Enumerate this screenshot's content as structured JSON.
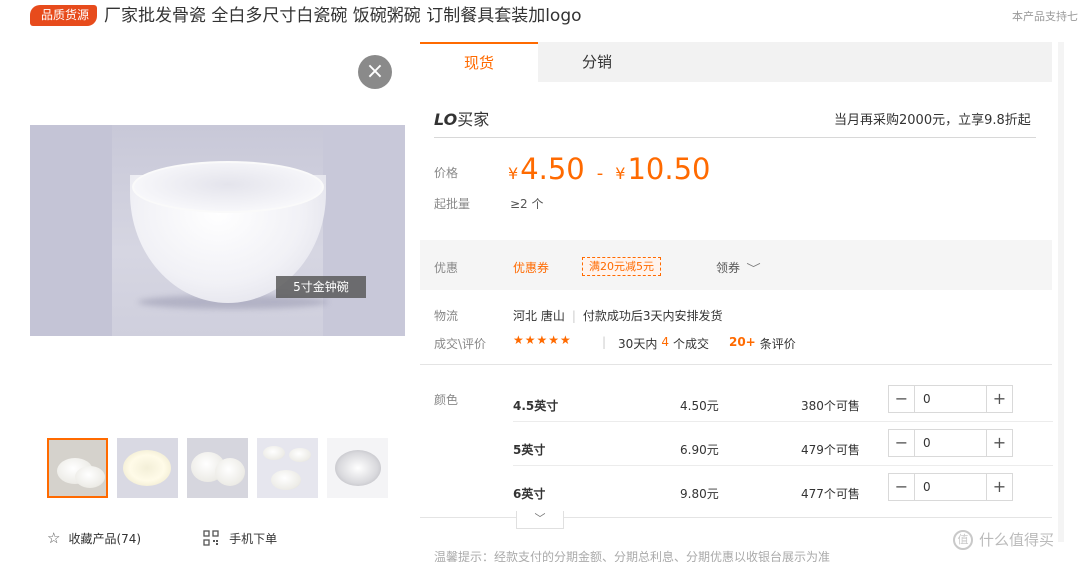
{
  "header": {
    "badge": "品质货源",
    "title": "厂家批发骨瓷 全白多尺寸白瓷碗 饭碗粥碗 订制餐具套装加logo",
    "support_note": "本产品支持七"
  },
  "gallery": {
    "close_glyph": "×",
    "main_image_caption": "5寸金钟碗",
    "thumbnail_count": 5
  },
  "actions": {
    "favorite_label": "收藏产品(74)",
    "mobile_order_label": "手机下单"
  },
  "tabs": [
    {
      "label": "现货",
      "active": true
    },
    {
      "label": "分销",
      "active": false
    }
  ],
  "seller": {
    "logo_prefix": "LO",
    "logo_suffix": "买家",
    "promo_note": "当月再采购2000元，立享9.8折起"
  },
  "pricing": {
    "price_label": "价格",
    "currency": "¥",
    "price_low": "4.50",
    "separator": "-",
    "price_high": "10.50",
    "moq_label": "起批量",
    "moq_value": "≥2 个"
  },
  "discount": {
    "label": "优惠",
    "coupon_text": "优惠券",
    "coupon_tag": "满20元减5元",
    "claim_text": "领券",
    "chevron_icon": "chevron-down-icon"
  },
  "logistics": {
    "label": "物流",
    "origin": "河北 唐山",
    "shipping": "付款成功后3天内安排发货"
  },
  "trade": {
    "label": "成交\\评价",
    "rating_stars": 5,
    "stars": "★★★★★",
    "deals_prefix": "30天内",
    "deals_count": "4",
    "deals_suffix": "个成交",
    "reviews_count": "20+",
    "reviews_suffix": "条评价"
  },
  "sku": {
    "label": "颜色",
    "rows": [
      {
        "name": "4.5英寸",
        "price": "4.50元",
        "stock": "380个可售",
        "qty": "0"
      },
      {
        "name": "5英寸",
        "price": "6.90元",
        "stock": "479个可售",
        "qty": "0"
      },
      {
        "name": "6英寸",
        "price": "9.80元",
        "stock": "477个可售",
        "qty": "0"
      }
    ],
    "minus_glyph": "−",
    "plus_glyph": "+",
    "more_glyph": "﹀"
  },
  "tip": "温馨提示：经款支付的分期金额、分期总利息、分期优惠以收银台展示为准",
  "watermark": {
    "icon_text": "值",
    "text": "什么值得买"
  },
  "colors": {
    "accent": "#ff6a00",
    "badge": "#e74b1c"
  }
}
